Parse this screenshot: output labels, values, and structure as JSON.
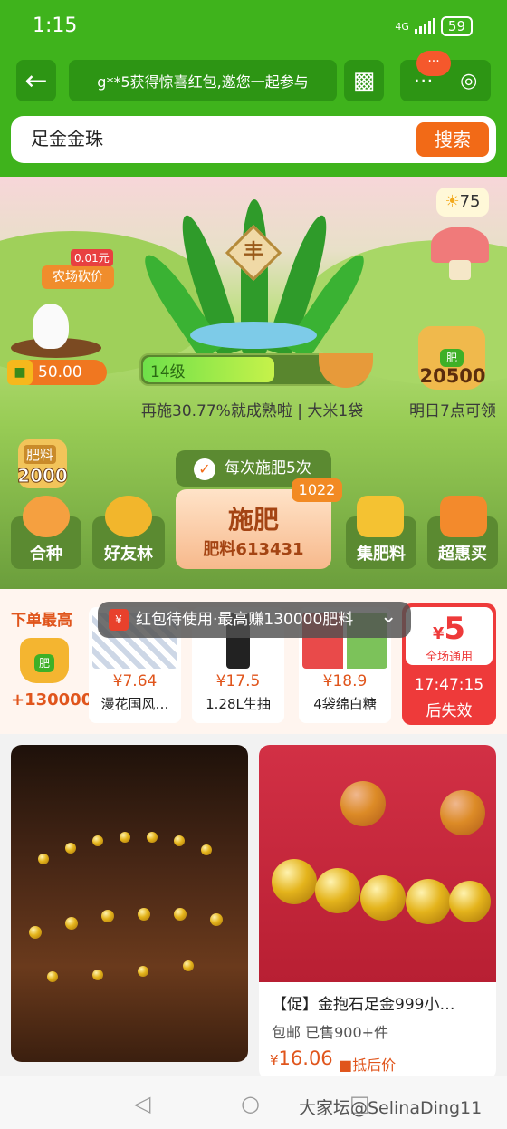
{
  "status": {
    "time": "1:15",
    "network": "4G",
    "battery": "59"
  },
  "nav": {
    "back_icon": "arrow-left-icon",
    "marquee": "g**5获得惊喜红包,邀您一起参与",
    "qr_icon": "qr-code-icon",
    "more_icon": "more-dots-icon",
    "close_icon": "mini-program-close-icon",
    "badge": "···"
  },
  "search": {
    "value": "足金金珠",
    "button": "搜索"
  },
  "farm": {
    "sun_count": "75",
    "plant_sign": "丰",
    "bargain": {
      "label": "农场砍价",
      "price": "0.01元"
    },
    "coins": "50.00",
    "level": {
      "label": "14级",
      "progress": 0.6
    },
    "progress_text": "再施30.77%就成熟啦 | 大米1袋",
    "fertilizer_bag": {
      "tag": "肥",
      "value": "20500"
    },
    "tomorrow_text": "明日7点可领",
    "small_fertilizer": {
      "label": "肥料",
      "value": "2000"
    },
    "each_time": "每次施肥5次",
    "fertilize": {
      "title": "施肥",
      "sub": "肥料613431",
      "count": "1022"
    },
    "actions": [
      {
        "label": "合种",
        "icon": "heart-icon"
      },
      {
        "label": "好友林",
        "icon": "trees-icon"
      },
      {
        "label": "集肥料",
        "icon": "fertilizer-bag-icon",
        "tag": "肥"
      },
      {
        "label": "超惠买",
        "icon": "shopping-bag-icon"
      }
    ]
  },
  "order": {
    "title": "下单最高",
    "bag_tag": "肥",
    "reward": "+130000",
    "banner": "红包待使用·最高赚130000肥料",
    "banner_icon": "¥",
    "products": [
      {
        "price": "¥7.64",
        "name": "漫花国风…"
      },
      {
        "price": "¥17.5",
        "name": "1.28L生抽"
      },
      {
        "price": "¥18.9",
        "name": "4袋绵白糖"
      }
    ],
    "coupon": {
      "currency": "¥",
      "amount": "5",
      "scope": "全场通用",
      "time": "17:47:15",
      "expire": "后失效"
    }
  },
  "feed": [
    {
      "title": "",
      "meta": "",
      "price": "",
      "tag": ""
    },
    {
      "title": "【促】金抱石足金999小…",
      "meta": "包邮 已售900+件",
      "price_symbol": "¥",
      "price": "16.06",
      "tag": "抵后价"
    }
  ],
  "bottom": {
    "watermark": "大家坛@SelinaDing11"
  },
  "colors": {
    "brand_green": "#3fb31c",
    "accent_orange": "#f26a17",
    "price_red": "#e0551c",
    "coupon_red": "#ee3a3a"
  }
}
